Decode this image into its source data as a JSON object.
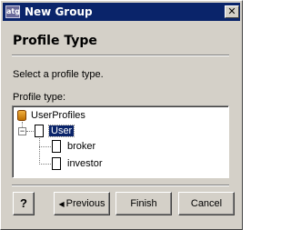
{
  "window": {
    "title": "New Group",
    "app_icon_text": "atg",
    "close_glyph": "✕"
  },
  "page": {
    "heading": "Profile Type",
    "description": "Select a profile type.",
    "tree_label": "Profile type:"
  },
  "tree": {
    "root": {
      "label": "UserProfiles",
      "icon": "database-icon"
    },
    "node": {
      "label": "User",
      "icon": "page-icon",
      "selected": true,
      "expanded": true
    },
    "children": [
      {
        "label": "broker",
        "icon": "page-icon"
      },
      {
        "label": "investor",
        "icon": "page-icon"
      }
    ]
  },
  "buttons": {
    "help": "?",
    "previous": "Previous",
    "previous_icon": "◀",
    "finish": "Finish",
    "cancel": "Cancel"
  },
  "colors": {
    "titlebar": "#0a246a",
    "selection": "#0a246a",
    "face": "#d4d0c8"
  }
}
